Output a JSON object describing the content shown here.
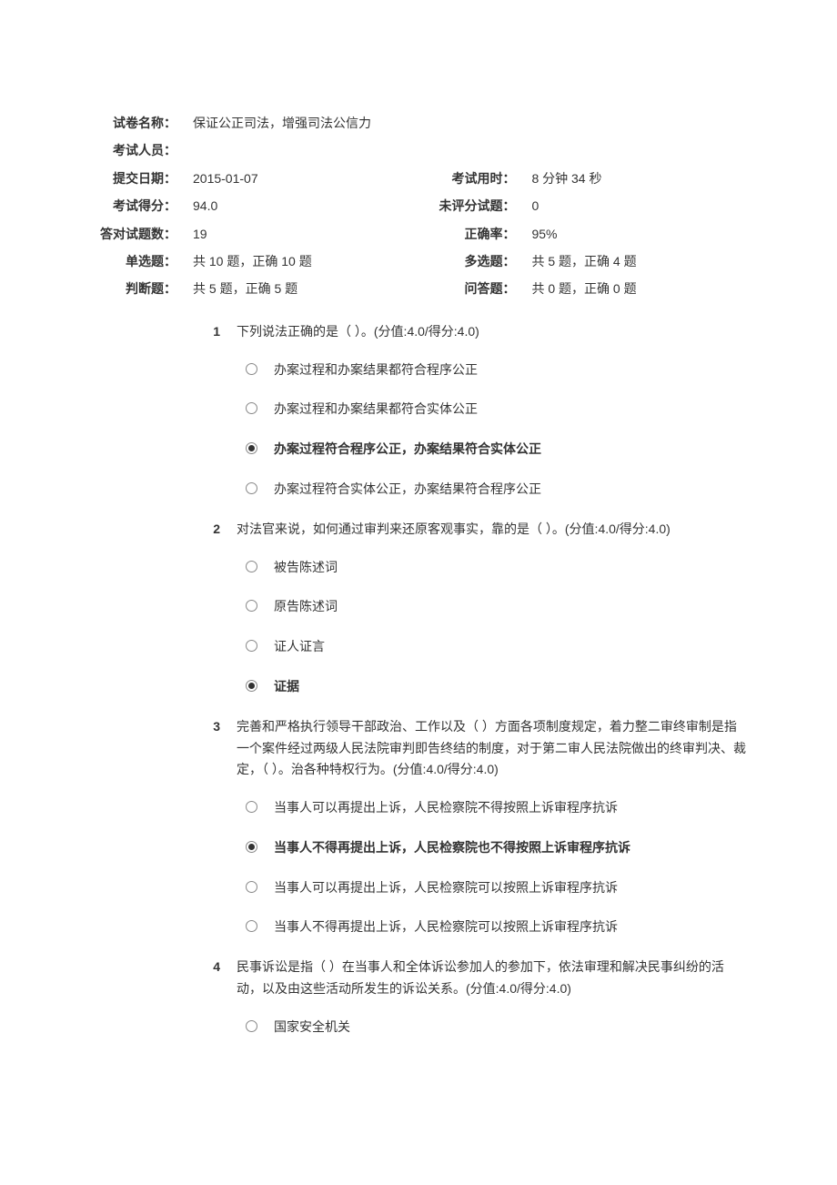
{
  "header": {
    "rows": [
      {
        "label1": "试卷名称：",
        "value1": "保证公正司法，增强司法公信力",
        "label2": "",
        "value2": ""
      },
      {
        "label1": "考试人员：",
        "value1": "",
        "label2": "",
        "value2": ""
      },
      {
        "label1": "提交日期：",
        "value1": "2015-01-07",
        "label2": "考试用时：",
        "value2": "8 分钟 34 秒"
      },
      {
        "label1": "考试得分：",
        "value1": "94.0",
        "label2": "未评分试题：",
        "value2": "0"
      },
      {
        "label1": "答对试题数：",
        "value1": "19",
        "label2": "正确率：",
        "value2": "95%"
      },
      {
        "label1": "单选题：",
        "value1": "共 10 题，正确 10 题",
        "label2": "多选题：",
        "value2": "共 5 题，正确 4 题"
      },
      {
        "label1": "判断题：",
        "value1": "共 5 题，正确 5 题",
        "label2": "问答题：",
        "value2": "共 0 题，正确 0 题"
      }
    ]
  },
  "questions": [
    {
      "num": "1",
      "text": "下列说法正确的是（ ）。(分值:4.0/得分:4.0)",
      "options": [
        {
          "text": "办案过程和办案结果都符合程序公正",
          "selected": false
        },
        {
          "text": "办案过程和办案结果都符合实体公正",
          "selected": false
        },
        {
          "text": "办案过程符合程序公正，办案结果符合实体公正",
          "selected": true
        },
        {
          "text": "办案过程符合实体公正，办案结果符合程序公正",
          "selected": false
        }
      ]
    },
    {
      "num": "2",
      "text": "对法官来说，如何通过审判来还原客观事实，靠的是（ ）。(分值:4.0/得分:4.0)",
      "options": [
        {
          "text": "被告陈述词",
          "selected": false
        },
        {
          "text": "原告陈述词",
          "selected": false
        },
        {
          "text": "证人证言",
          "selected": false
        },
        {
          "text": "证据",
          "selected": true
        }
      ]
    },
    {
      "num": "3",
      "text": "完善和严格执行领导干部政治、工作以及（ ）方面各项制度规定，着力整二审终审制是指一个案件经过两级人民法院审判即告终结的制度，对于第二审人民法院做出的终审判决、裁定，（ ）。治各种特权行为。(分值:4.0/得分:4.0)",
      "options": [
        {
          "text": "当事人可以再提出上诉，人民检察院不得按照上诉审程序抗诉",
          "selected": false
        },
        {
          "text": "当事人不得再提出上诉，人民检察院也不得按照上诉审程序抗诉",
          "selected": true
        },
        {
          "text": "当事人可以再提出上诉，人民检察院可以按照上诉审程序抗诉",
          "selected": false
        },
        {
          "text": "当事人不得再提出上诉，人民检察院可以按照上诉审程序抗诉",
          "selected": false
        }
      ]
    },
    {
      "num": "4",
      "text": "民事诉讼是指（ ）在当事人和全体诉讼参加人的参加下，依法审理和解决民事纠纷的活动，以及由这些活动所发生的诉讼关系。(分值:4.0/得分:4.0)",
      "options": [
        {
          "text": "国家安全机关",
          "selected": false
        }
      ]
    }
  ]
}
